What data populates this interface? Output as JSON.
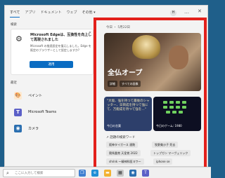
{
  "tabs": [
    {
      "label": "すべて"
    },
    {
      "label": "アプリ"
    },
    {
      "label": "ドキュメント"
    },
    {
      "label": "ウェブ"
    },
    {
      "label": "その他 ▾"
    }
  ],
  "header": {
    "avatar_initial": "H",
    "more_icon": "…",
    "close_icon": "✕"
  },
  "notification": {
    "section": "検索",
    "title": "Microsoft Edgeは、互換性を向上して再現されました",
    "body": "Microsoft の推奨設定を復元しました。Edge を既定のブラウザーとして設定しますか?",
    "button": "適用",
    "close": "✕"
  },
  "recent": {
    "section": "最近",
    "items": [
      {
        "label": "ペイント",
        "icon": "paint-icon",
        "color": "#e8a04a"
      },
      {
        "label": "Microsoft Teams",
        "icon": "teams-icon",
        "color": "#5b5fc7"
      },
      {
        "label": "カメラ",
        "icon": "camera-icon",
        "color": "#2b6fb0"
      }
    ]
  },
  "news": {
    "date": "今日 ・ 5月22日",
    "headline": "全仏オープ",
    "chips": [
      "詳細",
      "すべての画像"
    ],
    "cards": [
      {
        "text": "\"大坂、強を持つて最後のシャッター、日目成を持つて強にて、万能成を持つて強を…\"",
        "foot": "今日の言葉"
      },
      {
        "foot": "今日のゲーム: 1980"
      }
    ],
    "trending_heading": "↗ 話題の検索ワード",
    "trending": [
      "阪神タイガース 連敗",
      "牧野美沙子 死去",
      "競馬重賞 天皇賞 2022",
      "トップガン マーヴェリック",
      "shrink 〜精神科医ヨワ〜",
      "iphone se"
    ]
  },
  "taskbar": {
    "search_placeholder": "ここに入力して検索"
  },
  "colors": {
    "accent": "#0a6cc2",
    "highlight": "#e3201b"
  }
}
